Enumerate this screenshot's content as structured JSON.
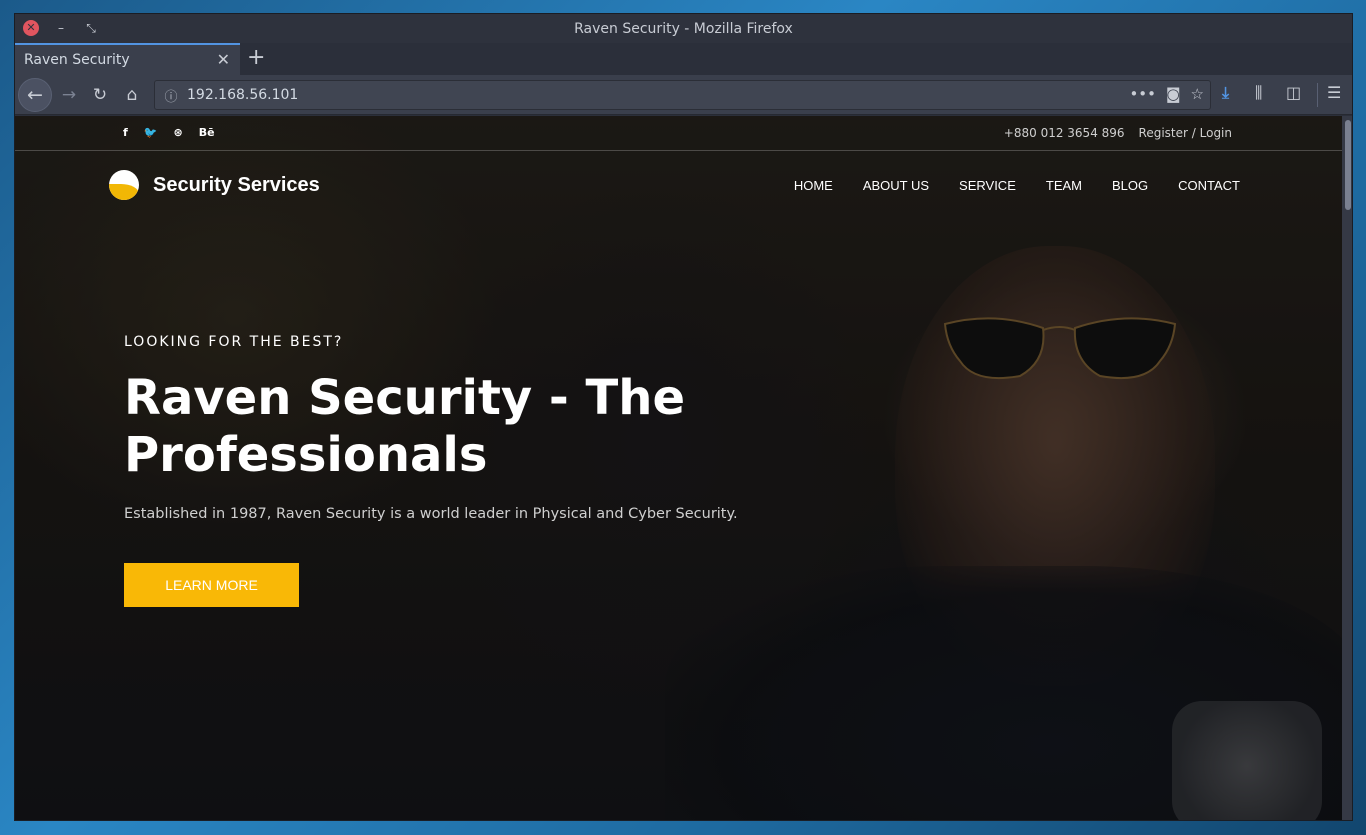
{
  "window": {
    "title": "Raven Security - Mozilla Firefox",
    "close_glyph": "✕",
    "min_glyph": "–",
    "max_glyph": "⤡"
  },
  "tabs": [
    {
      "label": "Raven Security",
      "active": true,
      "close_glyph": "✕"
    }
  ],
  "newtab_glyph": "+",
  "toolbar": {
    "back_icon": "arrow-left-icon",
    "forward_icon": "arrow-right-icon",
    "reload_icon": "reload-icon",
    "home_icon": "home-icon",
    "url": "192.168.56.101",
    "info_icon": "info-icon",
    "page_actions_icon": "ellipsis-icon",
    "pocket_icon": "pocket-icon",
    "bookmark_icon": "star-icon",
    "download_icon": "download-icon",
    "library_icon": "library-icon",
    "sidebar_icon": "sidebar-icon",
    "menu_icon": "hamburger-menu-icon"
  },
  "site": {
    "social": [
      "f",
      "🐦",
      "⊛",
      "Bē"
    ],
    "social_icons": [
      "facebook-icon",
      "twitter-icon",
      "dribbble-icon",
      "behance-icon"
    ],
    "phone": "+880 012 3654 896",
    "auth_link": "Register / Login",
    "brand": "Security Services",
    "nav": [
      "HOME",
      "ABOUT US",
      "SERVICE",
      "TEAM",
      "BLOG",
      "CONTACT"
    ],
    "hero": {
      "kicker": "LOOKING FOR THE BEST?",
      "title": "Raven Security - The Professionals",
      "subtitle": "Established in 1987, Raven Security is a world leader in Physical and Cyber Security.",
      "cta": "LEARN MORE"
    }
  },
  "colors": {
    "accent": "#f9b806",
    "tab_highlight": "#5294e2",
    "chrome_bg": "#3a3f4c"
  }
}
